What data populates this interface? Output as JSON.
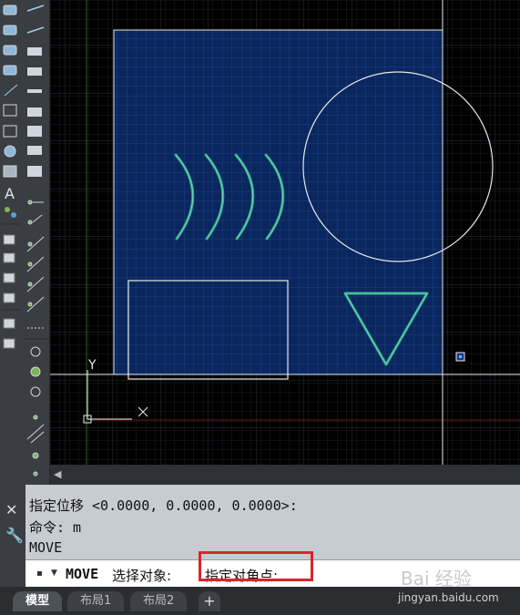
{
  "command_history": {
    "line1": "指定位移 <0.0000, 0.0000, 0.0000>:",
    "line2": "命令: m",
    "line3": "MOVE"
  },
  "command_input": {
    "command": "MOVE",
    "prompt": "选择对象:",
    "highlighted_prompt": "指定对角点:"
  },
  "tabs": [
    {
      "label": "模型",
      "active": true
    },
    {
      "label": "布局1",
      "active": false
    },
    {
      "label": "布局2",
      "active": false
    }
  ],
  "tab_add_label": "+",
  "ucs": {
    "x_label": "X",
    "y_label": "Y"
  },
  "watermark": {
    "logo": "Bai 经验",
    "url": "jingyan.baidu.com"
  },
  "colors": {
    "canvas_bg": "#000000",
    "selection_fill": "#0a2a66",
    "arc_color": "#2fa88a",
    "highlight_border": "#d8262c"
  },
  "icons": {
    "close": "close-icon",
    "customize": "wrench-icon",
    "scroll_left": "chevron-left-icon"
  }
}
